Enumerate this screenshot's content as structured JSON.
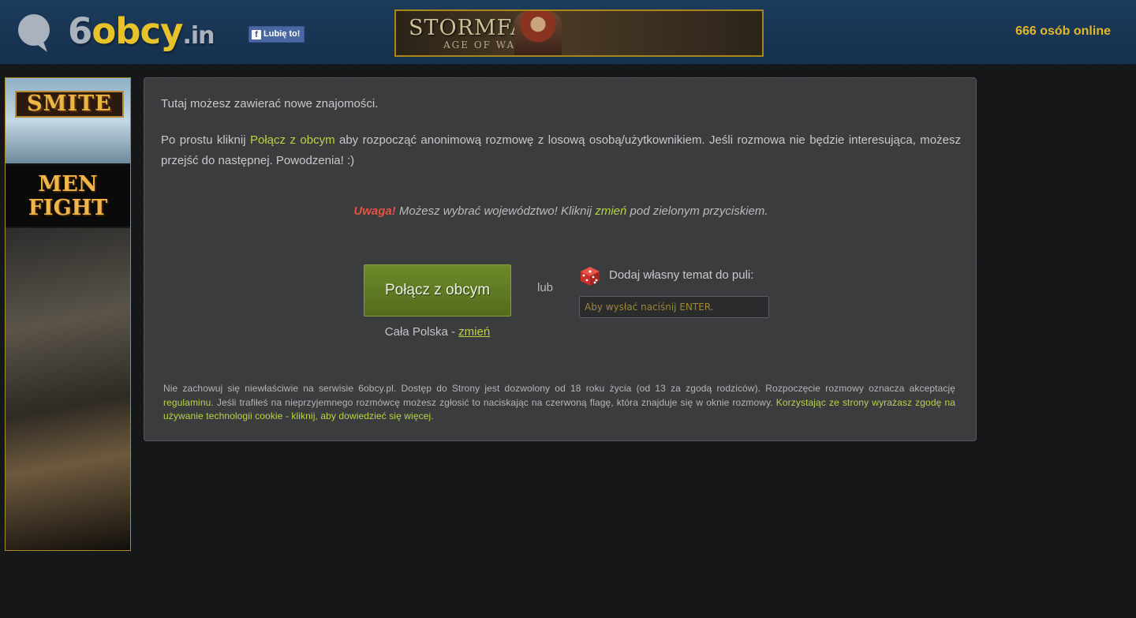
{
  "header": {
    "logo": {
      "part1": "6",
      "part2": "obcy",
      "part3": ".in"
    },
    "fb_like_label": "Lubię to!",
    "banner": {
      "title": "STORMFALL",
      "subtitle": "AGE OF WAR"
    },
    "online_count": "666 osób online"
  },
  "left_ad": {
    "logo": "SMITE",
    "tagline": "MEN FIGHT"
  },
  "main": {
    "intro": "Tutaj możesz zawierać nowe znajomości.",
    "desc_before": "Po prostu kliknij ",
    "desc_link": "Połącz z obcym",
    "desc_after": " aby rozpocząć anonimową rozmowę z losową osobą/użytkownikiem. Jeśli rozmowa nie będzie interesująca, możesz przejść do następnej. Powodzenia! :)",
    "notice": {
      "warning": "Uwaga!",
      "text_before": " Możesz wybrać województwo! Kliknij ",
      "link": "zmień",
      "text_after": " pod zielonym przyciskiem."
    },
    "connect_button": "Połącz z obcym",
    "region": {
      "text": "Cała Polska - ",
      "link": "zmień"
    },
    "or_label": "lub",
    "topic": {
      "label": "Dodaj własny temat do puli:",
      "placeholder": "Aby wysłać naciśnij ENTER."
    },
    "footer": {
      "part1": "Nie zachowuj się niewłaściwie na serwisie 6obcy.pl. Dostęp do Strony jest dozwolony od 18 roku życia (od 13 za zgodą rodziców). Rozpoczęcie rozmowy oznacza akceptację ",
      "rules_link": "regulaminu",
      "part2": ". Jeśli trafiłeś na nieprzyjemnego rozmówcę możesz zgłosić to naciskając na czerwoną flagę, która znajduje się w oknie rozmowy. ",
      "cookie_link": "Korzystając ze strony wyrażasz zgodę na używanie technologii cookie - kliknij, aby dowiedzieć się więcej."
    }
  },
  "colors": {
    "header_bg": "#1c3b5c",
    "accent_yellow": "#e2b72a",
    "lime_link": "#b7d44a",
    "warning_red": "#e05545",
    "button_green": "#6e8a2a",
    "panel_bg": "#3a3c3e"
  },
  "icons": [
    "chat-bubble-icon",
    "facebook-icon",
    "dice-icon"
  ]
}
